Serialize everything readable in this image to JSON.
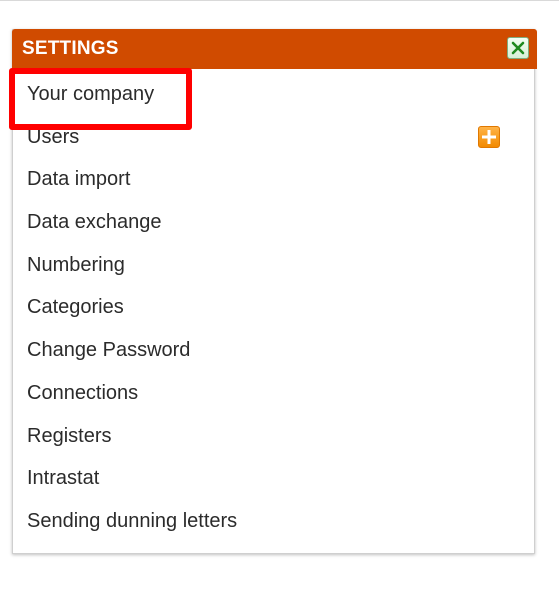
{
  "panel": {
    "title": "SETTINGS",
    "close_icon": "close-icon",
    "header_color": "#d04b00"
  },
  "menu": {
    "items": [
      {
        "label": "Your company"
      },
      {
        "label": "Users",
        "action_icon": "add-icon"
      },
      {
        "label": "Data import"
      },
      {
        "label": "Data exchange"
      },
      {
        "label": "Numbering"
      },
      {
        "label": "Categories"
      },
      {
        "label": "Change Password"
      },
      {
        "label": "Connections"
      },
      {
        "label": "Registers"
      },
      {
        "label": "Intrastat"
      },
      {
        "label": "Sending dunning letters"
      }
    ]
  },
  "annotation": {
    "highlight_color": "#ff0000",
    "highlighted_item": "Your company"
  }
}
